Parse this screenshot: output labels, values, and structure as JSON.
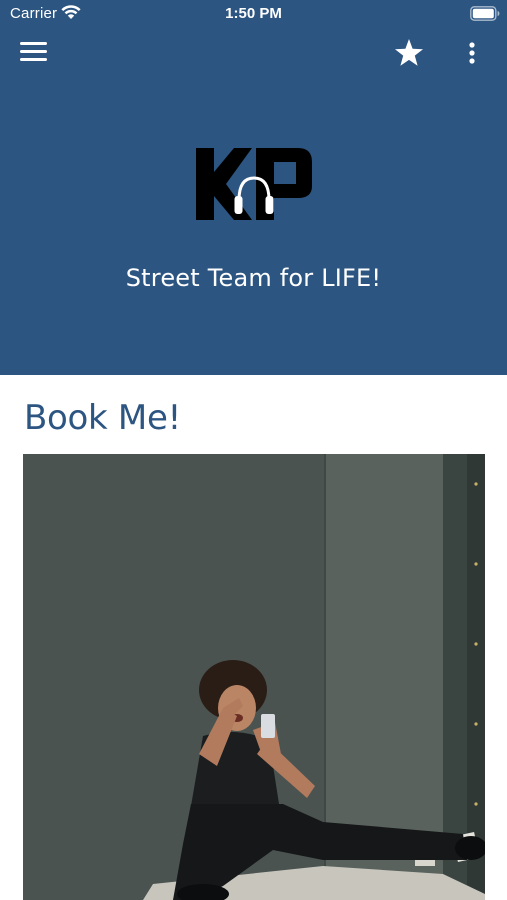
{
  "status_bar": {
    "carrier": "Carrier",
    "time": "1:50 PM"
  },
  "app_bar": {
    "menu_icon": "hamburger-menu-icon",
    "favorite_icon": "star-icon",
    "more_icon": "more-vertical-icon"
  },
  "header": {
    "logo": "KP headphones logo",
    "tagline": "Street Team for LIFE!"
  },
  "content": {
    "section_title": "Book Me!",
    "photo": "performer-photo"
  },
  "colors": {
    "header_background": "#2c5582",
    "title_color": "#2c5582",
    "text_on_header": "#ffffff"
  }
}
